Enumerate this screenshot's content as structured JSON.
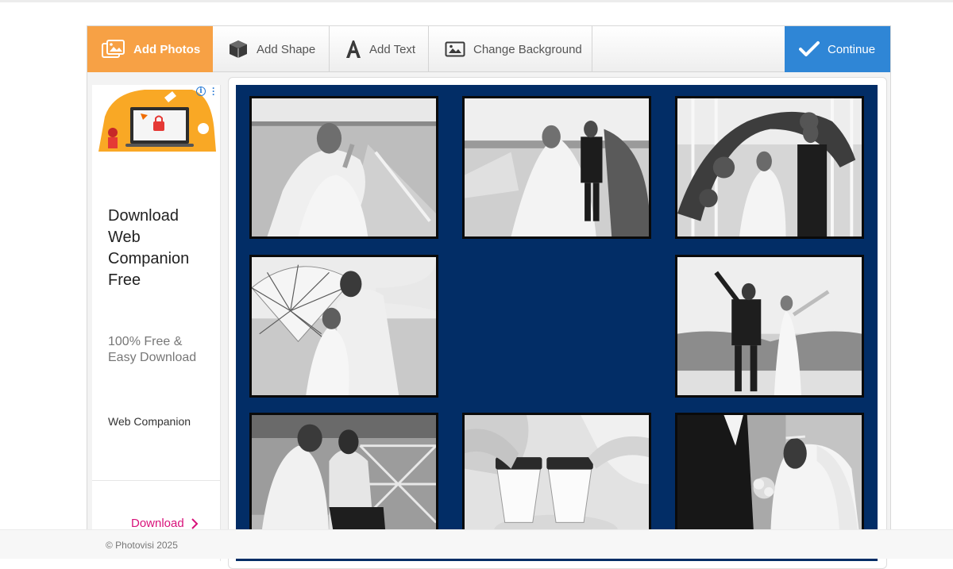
{
  "toolbar": {
    "add_photos": "Add Photos",
    "add_shape": "Add Shape",
    "add_text": "Add Text",
    "change_background": "Change Background",
    "continue": "Continue"
  },
  "ad": {
    "title": "Download Web Companion Free",
    "subtitle": "100% Free & Easy Download",
    "brand": "Web Companion",
    "cta": "Download",
    "info_icon": "info-icon",
    "menu_icon": "more-vertical-icon"
  },
  "collage": {
    "background_color": "#022d66",
    "photos": [
      {
        "name": "photo-bride-veil"
      },
      {
        "name": "photo-couple-pier"
      },
      {
        "name": "photo-couple-flower-arch"
      },
      {
        "name": "photo-couple-umbrella"
      },
      {
        "name": "photo-couple-celebrating"
      },
      {
        "name": "photo-couple-sitting"
      },
      {
        "name": "photo-coffee-cups"
      },
      {
        "name": "photo-groom-bride-bouquet"
      }
    ]
  },
  "footer": {
    "copyright": "© Photovisi 2025"
  },
  "colors": {
    "accent_orange": "#f7a145",
    "accent_blue": "#2f86d6",
    "ad_link": "#d8127a"
  }
}
